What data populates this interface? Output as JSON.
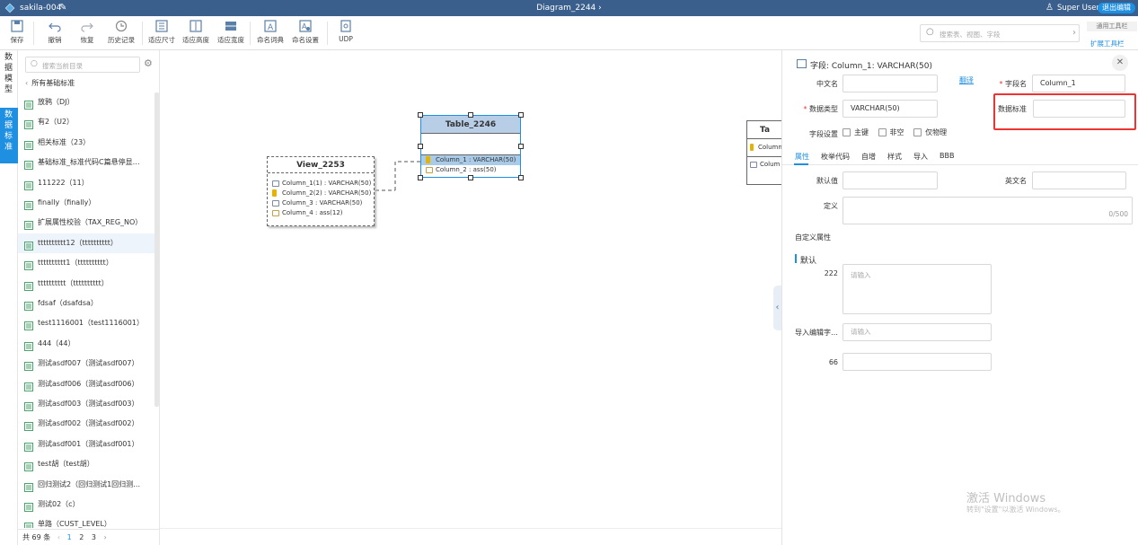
{
  "app": {
    "project": "sakila-004",
    "diagram": "Diagram_2244",
    "user": "Super User",
    "exit_label": "退出编辑"
  },
  "toolbar": {
    "buttons": [
      "保存",
      "撤销",
      "恢复",
      "历史记录",
      "适应尺寸",
      "适应高度",
      "适应宽度",
      "命名词典",
      "命名设置",
      "UDP"
    ],
    "search_placeholder": "搜索表、视图、字段",
    "common_tools": "通用工具栏",
    "extend_tools": "扩展工具栏"
  },
  "left_tabs": [
    {
      "label": "数据模型",
      "active": false
    },
    {
      "label": "数据标准",
      "active": true
    }
  ],
  "sidebar": {
    "search_placeholder": "搜索当前目录",
    "back_label": "所有基础标准",
    "items": [
      "放鸦（DJ）",
      "有2（U2）",
      "相关标准（23）",
      "基础标准_标准代码C篇悬停显…",
      "111222（11）",
      "finally（finally）",
      "扩展属性校验（TAX_REG_NO）",
      "tttttttttt12（tttttttttt）",
      "tttttttttt1（tttttttttt）",
      "tttttttttt（tttttttttt）",
      "fdsaf（dsafdsa）",
      "test1116001（test1116001）",
      "444（44）",
      "测试asdf007（测试asdf007）",
      "测试asdf006（测试asdf006）",
      "测试asdf003（测试asdf003）",
      "测试asdf002（测试asdf002）",
      "测试asdf001（测试asdf001）",
      "test胡（test胡）",
      "回归测试2（回归测试1回归测…",
      "测试02（c）",
      "单路（CUST_LEVEL）"
    ],
    "selected_index": 7,
    "pager": {
      "total": "共 69 条",
      "pages": [
        "1",
        "2",
        "3"
      ],
      "current": "1"
    }
  },
  "canvas": {
    "view": {
      "title": "View_2253",
      "columns": [
        "Column_1(1) : VARCHAR(50)",
        "Column_2(2) : VARCHAR(50)",
        "Column_3 : VARCHAR(50)",
        "Column_4 : ass(12)"
      ]
    },
    "table": {
      "title": "Table_2246",
      "columns": [
        "Column_1 : VARCHAR(50)",
        "Column_2 : ass(50)"
      ]
    },
    "table2": {
      "title": "Ta",
      "columns": [
        "Column",
        "Colum"
      ]
    }
  },
  "panel": {
    "title": "字段: Column_1: VARCHAR(50)",
    "cn_name_label": "中文名",
    "cn_name_value": "",
    "translate_link": "翻译",
    "field_name_label": "字段名",
    "field_name_value": "Column_1",
    "data_type_label": "数据类型",
    "data_type_value": "VARCHAR(50)",
    "data_std_label": "数据标准",
    "data_std_value": "",
    "field_setting_label": "字段设置",
    "checkboxes": [
      "主键",
      "非空",
      "仅物理"
    ],
    "tabs": [
      "属性",
      "枚举代码",
      "自增",
      "样式",
      "导入",
      "BBB"
    ],
    "active_tab": "属性",
    "default_label": "默认值",
    "default_value": "",
    "en_name_label": "英文名",
    "en_name_value": "",
    "def_label": "定义",
    "def_counter": "0/500",
    "custom_attr_label": "自定义属性",
    "section_label": "默认",
    "attr1_label": "222",
    "attr1_placeholder": "请输入",
    "attr2_label": "导入编辑字…",
    "attr2_placeholder": "请输入",
    "attr3_label": "66",
    "attr3_value": "",
    "highlight_color": "#e33"
  },
  "watermark": {
    "line1": "激活 Windows",
    "line2": "转到\"设置\"以激活 Windows。"
  }
}
